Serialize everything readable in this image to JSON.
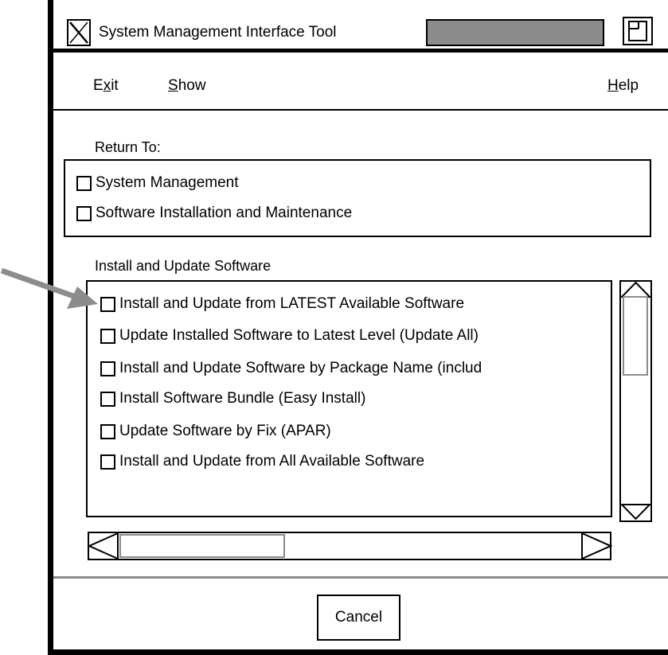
{
  "window": {
    "title": "System Management Interface Tool"
  },
  "menubar": {
    "exit": {
      "mnemonic": "E",
      "accel": "x",
      "rest": "it"
    },
    "show": {
      "mnemonic": "S",
      "rest": "how"
    },
    "help": {
      "mnemonic": "H",
      "rest": "elp"
    }
  },
  "return_to": {
    "label": "Return To:",
    "items": [
      {
        "label": "System Management"
      },
      {
        "label": "Software Installation and Maintenance"
      }
    ]
  },
  "install_list": {
    "label": "Install and Update Software",
    "items": [
      {
        "label": "Install and Update from LATEST Available Software"
      },
      {
        "label": "Update Installed Software to Latest Level (Update All)"
      },
      {
        "label": "Install and Update Software by Package Name (includ"
      },
      {
        "label": "Install Software Bundle (Easy Install)"
      },
      {
        "label": "Update Software by Fix (APAR)"
      },
      {
        "label": "Install and Update from All Available Software"
      }
    ]
  },
  "footer": {
    "cancel_label": "Cancel"
  },
  "icons": {
    "app": "x-logo-icon",
    "maximize": "maximize-icon",
    "pointer": "arrow-pointer-icon"
  },
  "colors": {
    "frame": "#000000",
    "accent_gray": "#8c8c8c",
    "background": "#ffffff"
  }
}
